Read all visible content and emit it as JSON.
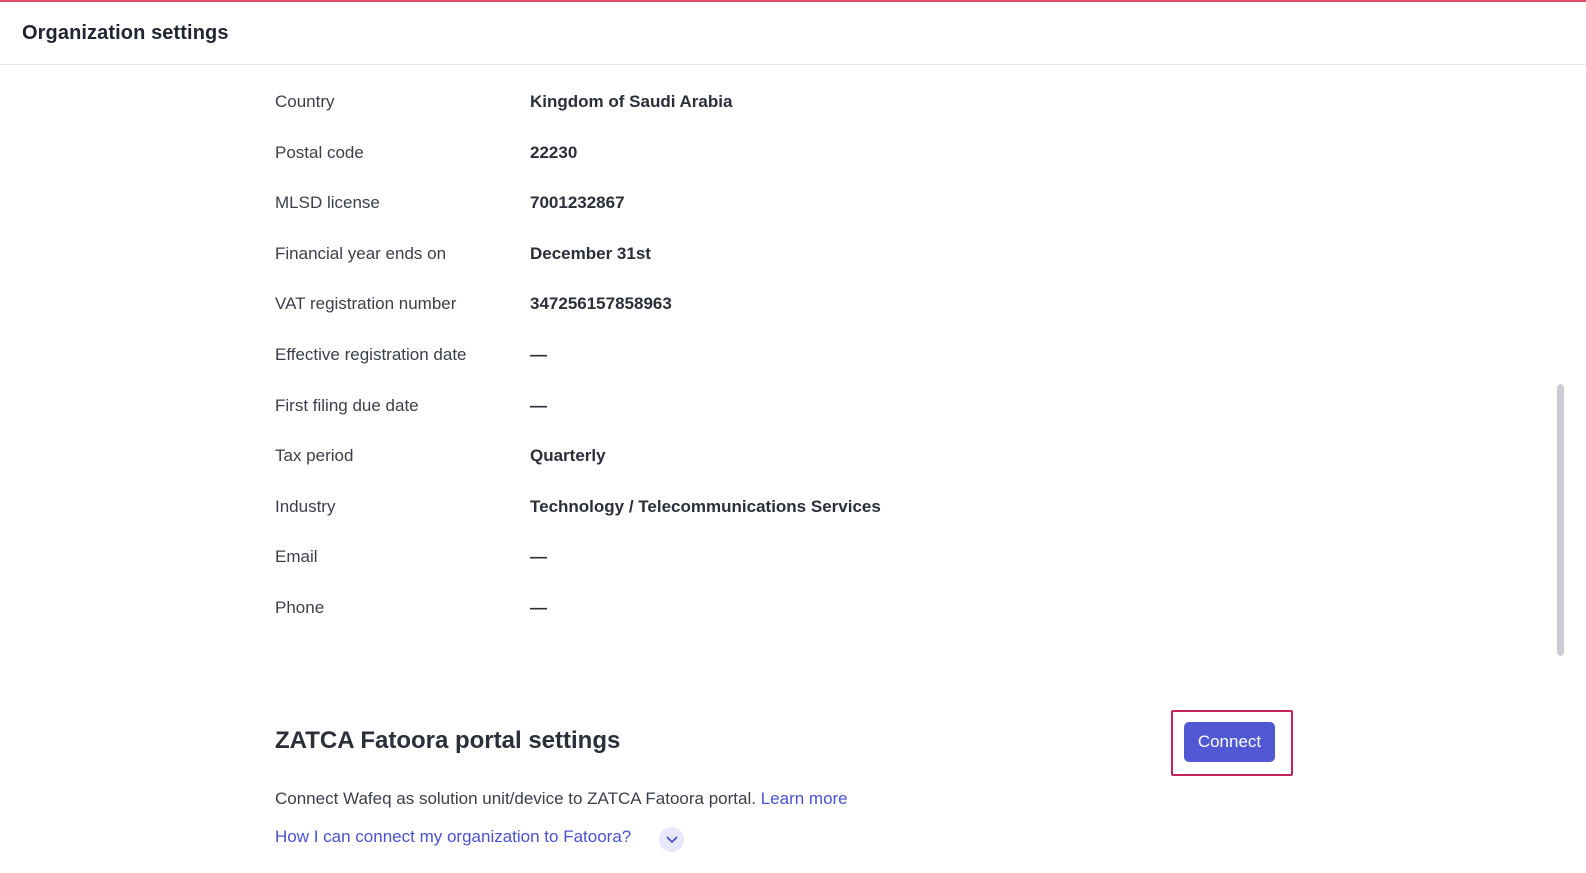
{
  "header": {
    "title": "Organization settings"
  },
  "details": {
    "rows": [
      {
        "label": "Country",
        "value": "Kingdom of Saudi Arabia"
      },
      {
        "label": "Postal code",
        "value": "22230"
      },
      {
        "label": "MLSD license",
        "value": "7001232867"
      },
      {
        "label": "Financial year ends on",
        "value": "December 31st"
      },
      {
        "label": "VAT registration number",
        "value": "347256157858963"
      },
      {
        "label": "Effective registration date",
        "value": "—"
      },
      {
        "label": "First filing due date",
        "value": "—"
      },
      {
        "label": "Tax period",
        "value": "Quarterly"
      },
      {
        "label": "Industry",
        "value": "Technology / Telecommunications Services"
      },
      {
        "label": "Email",
        "value": "—"
      },
      {
        "label": "Phone",
        "value": "—"
      }
    ]
  },
  "zatca": {
    "title": "ZATCA Fatoora portal settings",
    "connect_label": "Connect",
    "description": "Connect Wafeq as solution unit/device to ZATCA Fatoora portal.",
    "learn_more": "Learn more",
    "how_to": "How I can connect my organization to Fatoora?"
  },
  "icons": {
    "how_to_toggle": "chevron-down-icon"
  },
  "colors": {
    "accent_top": "#e34c6a",
    "primary": "#5158d4",
    "link": "#4a52d1",
    "focus_outline": "#c2245a"
  }
}
